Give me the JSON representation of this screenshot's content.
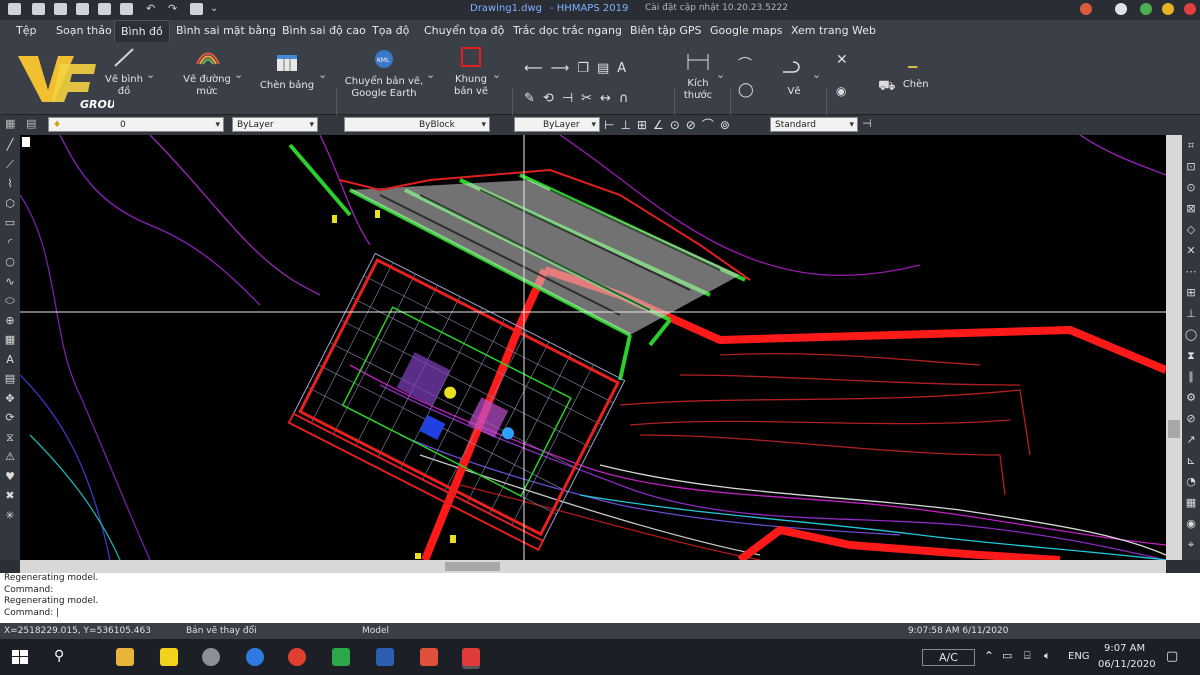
{
  "titlebar": {
    "file": "Drawing1.dwg",
    "app": "- HHMAPS 2019",
    "update": "Cài đặt cập nhật 10.20.23.5222"
  },
  "menu": [
    "Tệp",
    "Soạn thảo",
    "Bình đồ",
    "Bình sai mặt bằng",
    "Bình sai độ cao",
    "Tọa độ",
    "Chuyển tọa độ",
    "Trắc dọc trắc ngang",
    "Biên tập GPS",
    "Google maps",
    "Xem trang Web"
  ],
  "ribbon": {
    "logo_group": "GROUP",
    "ve_binh_do": "Vẽ bình đồ",
    "ve_duong_muc": "Vẽ đường mức",
    "chen_bang": "Chèn bảng",
    "chuyen_ban_ve": "Chuyển bản vẽ, Google Earth",
    "khung_ban_ve": "Khung bản vẽ",
    "kich_thuoc": "Kích thước",
    "ve": "Vẽ",
    "chen": "Chèn"
  },
  "props": {
    "layer": "0",
    "color": "ByLayer",
    "linetype": "ByBlock",
    "lineweight": "ByLayer",
    "style": "Standard"
  },
  "command": {
    "lines": [
      "Regenerating model.",
      "Command:",
      "Regenerating model.",
      "Command:"
    ]
  },
  "status": {
    "coords": "X=2518229.015, Y=536105.463",
    "changed": "Bản vẽ thay đổi",
    "model": "Model",
    "timestamp": "9:07:58 AM 6/11/2020"
  },
  "tray": {
    "ac": "A/C",
    "lang": "ENG",
    "time": "9:07 AM",
    "date": "06/11/2020"
  },
  "colors": {
    "accent": "#4da3ff",
    "drawing_red": "#ff1a1a",
    "drawing_green": "#22c022",
    "drawing_magenta": "#a020c0"
  }
}
